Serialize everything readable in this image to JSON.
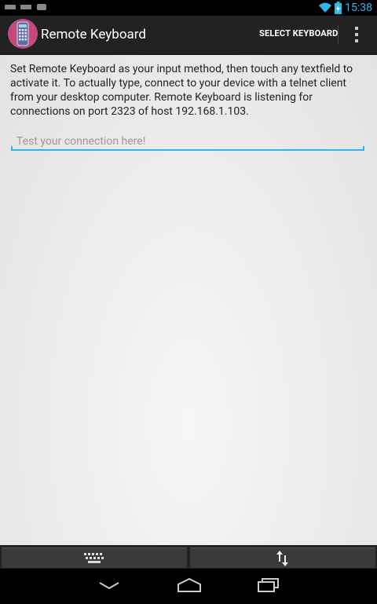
{
  "status_bar": {
    "time": "15:38",
    "left_icons": [
      "notification-icon-1",
      "notification-icon-2",
      "notification-icon-3"
    ],
    "right_icons": [
      "wifi-icon",
      "battery-charging-icon"
    ]
  },
  "action_bar": {
    "title": "Remote Keyboard",
    "select_keyboard_label": "SELECT KEYBOARD",
    "overflow_icon": "overflow-menu-icon"
  },
  "main": {
    "instructions": "Set Remote Keyboard as your input method, then touch any textfield to activate it. To actually type, connect to your device with a telnet client from your desktop computer. Remote Keyboard is listening for connections on port 2323 of host 192.168.1.103.",
    "test_field_placeholder": "Test your connection here!"
  },
  "bottom_buttons": {
    "left_icon": "keyboard-icon",
    "right_icon": "up-down-arrows-icon"
  },
  "nav_bar": {
    "icons": [
      "back-icon",
      "home-icon",
      "recent-apps-icon"
    ]
  },
  "colors": {
    "accent": "#33b5e5",
    "action_bar": "#222222",
    "app_icon": "#c34a7c"
  }
}
